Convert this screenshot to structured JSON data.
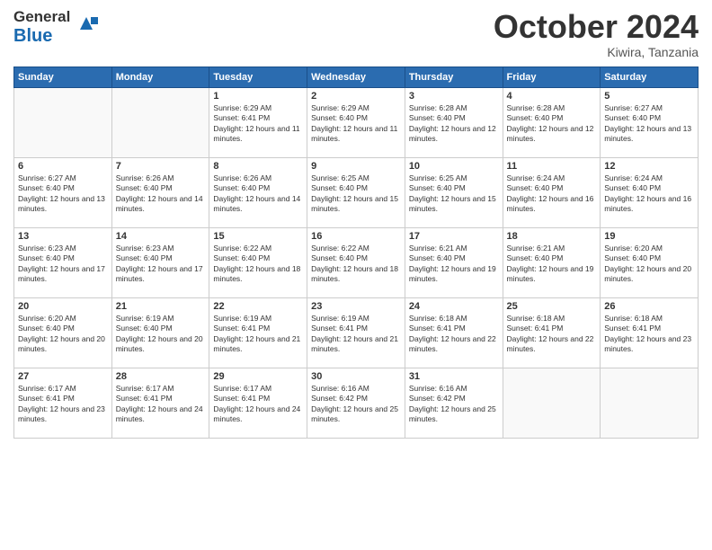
{
  "logo": {
    "text_general": "General",
    "text_blue": "Blue"
  },
  "header": {
    "month_title": "October 2024",
    "location": "Kiwira, Tanzania"
  },
  "days_of_week": [
    "Sunday",
    "Monday",
    "Tuesday",
    "Wednesday",
    "Thursday",
    "Friday",
    "Saturday"
  ],
  "weeks": [
    [
      {
        "day": "",
        "sunrise": "",
        "sunset": "",
        "daylight": ""
      },
      {
        "day": "",
        "sunrise": "",
        "sunset": "",
        "daylight": ""
      },
      {
        "day": "1",
        "sunrise": "Sunrise: 6:29 AM",
        "sunset": "Sunset: 6:41 PM",
        "daylight": "Daylight: 12 hours and 11 minutes."
      },
      {
        "day": "2",
        "sunrise": "Sunrise: 6:29 AM",
        "sunset": "Sunset: 6:40 PM",
        "daylight": "Daylight: 12 hours and 11 minutes."
      },
      {
        "day": "3",
        "sunrise": "Sunrise: 6:28 AM",
        "sunset": "Sunset: 6:40 PM",
        "daylight": "Daylight: 12 hours and 12 minutes."
      },
      {
        "day": "4",
        "sunrise": "Sunrise: 6:28 AM",
        "sunset": "Sunset: 6:40 PM",
        "daylight": "Daylight: 12 hours and 12 minutes."
      },
      {
        "day": "5",
        "sunrise": "Sunrise: 6:27 AM",
        "sunset": "Sunset: 6:40 PM",
        "daylight": "Daylight: 12 hours and 13 minutes."
      }
    ],
    [
      {
        "day": "6",
        "sunrise": "Sunrise: 6:27 AM",
        "sunset": "Sunset: 6:40 PM",
        "daylight": "Daylight: 12 hours and 13 minutes."
      },
      {
        "day": "7",
        "sunrise": "Sunrise: 6:26 AM",
        "sunset": "Sunset: 6:40 PM",
        "daylight": "Daylight: 12 hours and 14 minutes."
      },
      {
        "day": "8",
        "sunrise": "Sunrise: 6:26 AM",
        "sunset": "Sunset: 6:40 PM",
        "daylight": "Daylight: 12 hours and 14 minutes."
      },
      {
        "day": "9",
        "sunrise": "Sunrise: 6:25 AM",
        "sunset": "Sunset: 6:40 PM",
        "daylight": "Daylight: 12 hours and 15 minutes."
      },
      {
        "day": "10",
        "sunrise": "Sunrise: 6:25 AM",
        "sunset": "Sunset: 6:40 PM",
        "daylight": "Daylight: 12 hours and 15 minutes."
      },
      {
        "day": "11",
        "sunrise": "Sunrise: 6:24 AM",
        "sunset": "Sunset: 6:40 PM",
        "daylight": "Daylight: 12 hours and 16 minutes."
      },
      {
        "day": "12",
        "sunrise": "Sunrise: 6:24 AM",
        "sunset": "Sunset: 6:40 PM",
        "daylight": "Daylight: 12 hours and 16 minutes."
      }
    ],
    [
      {
        "day": "13",
        "sunrise": "Sunrise: 6:23 AM",
        "sunset": "Sunset: 6:40 PM",
        "daylight": "Daylight: 12 hours and 17 minutes."
      },
      {
        "day": "14",
        "sunrise": "Sunrise: 6:23 AM",
        "sunset": "Sunset: 6:40 PM",
        "daylight": "Daylight: 12 hours and 17 minutes."
      },
      {
        "day": "15",
        "sunrise": "Sunrise: 6:22 AM",
        "sunset": "Sunset: 6:40 PM",
        "daylight": "Daylight: 12 hours and 18 minutes."
      },
      {
        "day": "16",
        "sunrise": "Sunrise: 6:22 AM",
        "sunset": "Sunset: 6:40 PM",
        "daylight": "Daylight: 12 hours and 18 minutes."
      },
      {
        "day": "17",
        "sunrise": "Sunrise: 6:21 AM",
        "sunset": "Sunset: 6:40 PM",
        "daylight": "Daylight: 12 hours and 19 minutes."
      },
      {
        "day": "18",
        "sunrise": "Sunrise: 6:21 AM",
        "sunset": "Sunset: 6:40 PM",
        "daylight": "Daylight: 12 hours and 19 minutes."
      },
      {
        "day": "19",
        "sunrise": "Sunrise: 6:20 AM",
        "sunset": "Sunset: 6:40 PM",
        "daylight": "Daylight: 12 hours and 20 minutes."
      }
    ],
    [
      {
        "day": "20",
        "sunrise": "Sunrise: 6:20 AM",
        "sunset": "Sunset: 6:40 PM",
        "daylight": "Daylight: 12 hours and 20 minutes."
      },
      {
        "day": "21",
        "sunrise": "Sunrise: 6:19 AM",
        "sunset": "Sunset: 6:40 PM",
        "daylight": "Daylight: 12 hours and 20 minutes."
      },
      {
        "day": "22",
        "sunrise": "Sunrise: 6:19 AM",
        "sunset": "Sunset: 6:41 PM",
        "daylight": "Daylight: 12 hours and 21 minutes."
      },
      {
        "day": "23",
        "sunrise": "Sunrise: 6:19 AM",
        "sunset": "Sunset: 6:41 PM",
        "daylight": "Daylight: 12 hours and 21 minutes."
      },
      {
        "day": "24",
        "sunrise": "Sunrise: 6:18 AM",
        "sunset": "Sunset: 6:41 PM",
        "daylight": "Daylight: 12 hours and 22 minutes."
      },
      {
        "day": "25",
        "sunrise": "Sunrise: 6:18 AM",
        "sunset": "Sunset: 6:41 PM",
        "daylight": "Daylight: 12 hours and 22 minutes."
      },
      {
        "day": "26",
        "sunrise": "Sunrise: 6:18 AM",
        "sunset": "Sunset: 6:41 PM",
        "daylight": "Daylight: 12 hours and 23 minutes."
      }
    ],
    [
      {
        "day": "27",
        "sunrise": "Sunrise: 6:17 AM",
        "sunset": "Sunset: 6:41 PM",
        "daylight": "Daylight: 12 hours and 23 minutes."
      },
      {
        "day": "28",
        "sunrise": "Sunrise: 6:17 AM",
        "sunset": "Sunset: 6:41 PM",
        "daylight": "Daylight: 12 hours and 24 minutes."
      },
      {
        "day": "29",
        "sunrise": "Sunrise: 6:17 AM",
        "sunset": "Sunset: 6:41 PM",
        "daylight": "Daylight: 12 hours and 24 minutes."
      },
      {
        "day": "30",
        "sunrise": "Sunrise: 6:16 AM",
        "sunset": "Sunset: 6:42 PM",
        "daylight": "Daylight: 12 hours and 25 minutes."
      },
      {
        "day": "31",
        "sunrise": "Sunrise: 6:16 AM",
        "sunset": "Sunset: 6:42 PM",
        "daylight": "Daylight: 12 hours and 25 minutes."
      },
      {
        "day": "",
        "sunrise": "",
        "sunset": "",
        "daylight": ""
      },
      {
        "day": "",
        "sunrise": "",
        "sunset": "",
        "daylight": ""
      }
    ]
  ]
}
